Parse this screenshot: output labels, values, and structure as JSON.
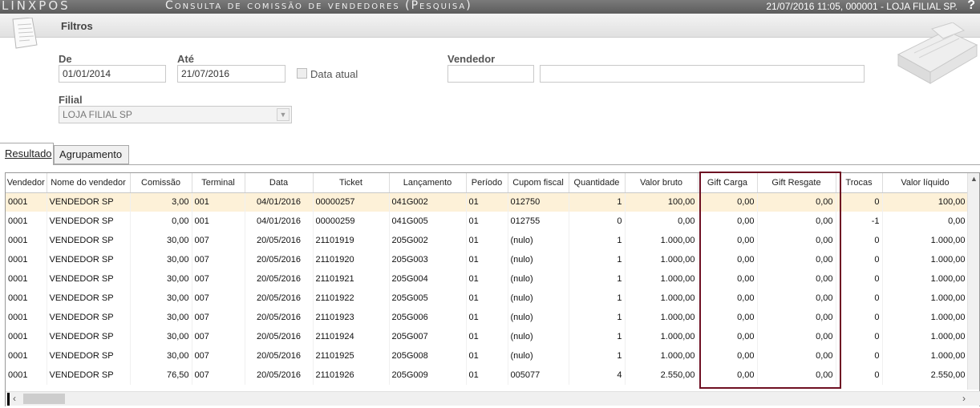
{
  "titlebar": {
    "logo": "LINXPOS",
    "title": "Consulta de comissão de vendedores (Pesquisa)",
    "status": "21/07/2016 11:05, 000001 - LOJA FILIAL SP.",
    "help": "?"
  },
  "filters": {
    "header": "Filtros",
    "de_label": "De",
    "de_value": "01/01/2014",
    "ate_label": "Até",
    "ate_value": "21/07/2016",
    "data_atual_label": "Data atual",
    "vendedor_label": "Vendedor",
    "vendedor_code": "",
    "vendedor_name": "",
    "filial_label": "Filial",
    "filial_value": "LOJA FILIAL SP"
  },
  "tabs": {
    "resultado": "Resultado",
    "agrupamento": "Agrupamento"
  },
  "grid": {
    "columns": [
      "Vendedor",
      "Nome do vendedor",
      "Comissão",
      "Terminal",
      "Data",
      "Ticket",
      "Lançamento",
      "Período",
      "Cupom fiscal",
      "Quantidade",
      "Valor bruto",
      "Gift Carga",
      "Gift Resgate",
      "Trocas",
      "Valor líquido"
    ],
    "rows": [
      [
        "0001",
        "VENDEDOR SP",
        "3,00",
        "001",
        "04/01/2016",
        "00000257",
        "041G002",
        "01",
        "012750",
        "1",
        "100,00",
        "0,00",
        "0,00",
        "0",
        "100,00"
      ],
      [
        "0001",
        "VENDEDOR SP",
        "0,00",
        "001",
        "04/01/2016",
        "00000259",
        "041G005",
        "01",
        "012755",
        "0",
        "0,00",
        "0,00",
        "0,00",
        "-1",
        "0,00"
      ],
      [
        "0001",
        "VENDEDOR SP",
        "30,00",
        "007",
        "20/05/2016",
        "21101919",
        "205G002",
        "01",
        "(nulo)",
        "1",
        "1.000,00",
        "0,00",
        "0,00",
        "0",
        "1.000,00"
      ],
      [
        "0001",
        "VENDEDOR SP",
        "30,00",
        "007",
        "20/05/2016",
        "21101920",
        "205G003",
        "01",
        "(nulo)",
        "1",
        "1.000,00",
        "0,00",
        "0,00",
        "0",
        "1.000,00"
      ],
      [
        "0001",
        "VENDEDOR SP",
        "30,00",
        "007",
        "20/05/2016",
        "21101921",
        "205G004",
        "01",
        "(nulo)",
        "1",
        "1.000,00",
        "0,00",
        "0,00",
        "0",
        "1.000,00"
      ],
      [
        "0001",
        "VENDEDOR SP",
        "30,00",
        "007",
        "20/05/2016",
        "21101922",
        "205G005",
        "01",
        "(nulo)",
        "1",
        "1.000,00",
        "0,00",
        "0,00",
        "0",
        "1.000,00"
      ],
      [
        "0001",
        "VENDEDOR SP",
        "30,00",
        "007",
        "20/05/2016",
        "21101923",
        "205G006",
        "01",
        "(nulo)",
        "1",
        "1.000,00",
        "0,00",
        "0,00",
        "0",
        "1.000,00"
      ],
      [
        "0001",
        "VENDEDOR SP",
        "30,00",
        "007",
        "20/05/2016",
        "21101924",
        "205G007",
        "01",
        "(nulo)",
        "1",
        "1.000,00",
        "0,00",
        "0,00",
        "0",
        "1.000,00"
      ],
      [
        "0001",
        "VENDEDOR SP",
        "30,00",
        "007",
        "20/05/2016",
        "21101925",
        "205G008",
        "01",
        "(nulo)",
        "1",
        "1.000,00",
        "0,00",
        "0,00",
        "0",
        "1.000,00"
      ],
      [
        "0001",
        "VENDEDOR SP",
        "76,50",
        "007",
        "20/05/2016",
        "21101926",
        "205G009",
        "01",
        "005077",
        "4",
        "2.550,00",
        "0,00",
        "0,00",
        "0",
        "2.550,00"
      ]
    ]
  },
  "colors": {
    "highlight_border": "#6e0f22",
    "selected_row": "#fdf1d8"
  }
}
